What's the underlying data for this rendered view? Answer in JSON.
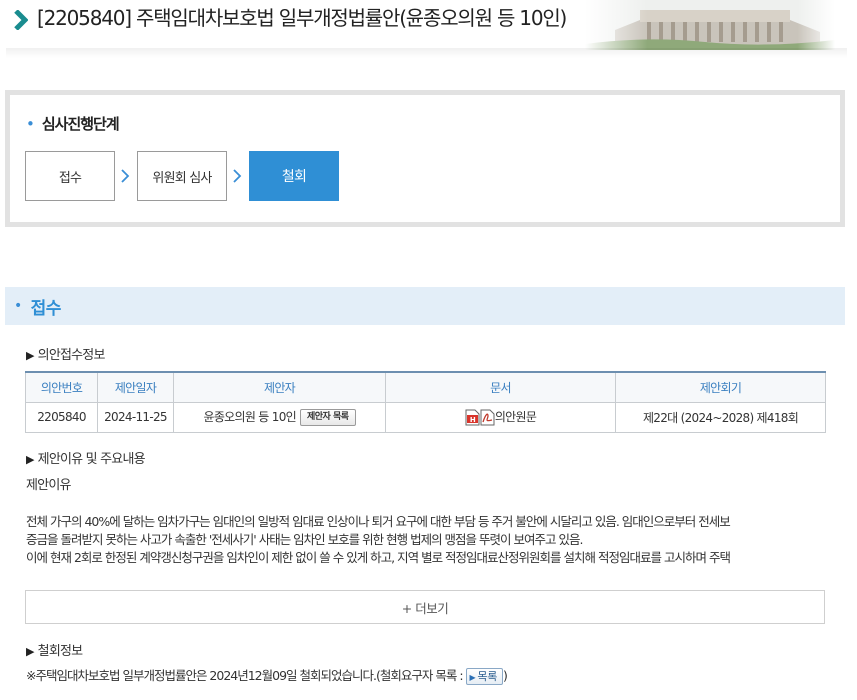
{
  "header": {
    "bill_title": "[2205840] 주택임대차보호법 일부개정법률안(윤종오의원 등 10인)"
  },
  "stages": {
    "heading": "심사진행단계",
    "steps": [
      {
        "label": "접수",
        "active": false
      },
      {
        "label": "위원회 심사",
        "active": false
      },
      {
        "label": "철회",
        "active": true
      }
    ]
  },
  "section": {
    "title": "접수"
  },
  "receipt_info": {
    "heading": "의안접수정보",
    "columns": [
      "의안번호",
      "제안일자",
      "제안자",
      "문서",
      "제안회기"
    ],
    "row": {
      "bill_no": "2205840",
      "date": "2024-11-25",
      "proposer": "윤종오의원 등 10인",
      "proposer_button": "제안자 목록",
      "document": "의안원문",
      "session": "제22대 (2024~2028) 제418회"
    }
  },
  "reason": {
    "heading": "제안이유 및 주요내용",
    "label": "제안이유",
    "lines": [
      "전체 가구의 40%에 달하는 임차가구는 임대인의 일방적 임대료 인상이나 퇴거 요구에 대한 부담 등 주거 불안에 시달리고 있음. 임대인으로부터 전세보",
      "증금을 돌려받지 못하는 사고가 속출한 '전세사기' 사태는 임차인 보호를 위한 현행 법제의 맹점을 뚜렷이 보여주고 있음.",
      "이에 현재 2회로 한정된 계약갱신청구권을 임차인이 제한 없이 쓸 수 있게 하고, 지역 별로 적정임대료산정위원회를 설치해 적정임대료를 고시하며 주택"
    ],
    "more_button": "+ 더보기"
  },
  "withdrawal": {
    "heading": "철회정보",
    "note": "※주택임대차보호법 일부개정법률안은 2024년12월09일 철회되었습니다.(철회요구자 목록 :",
    "list_button": "목록",
    "close_paren": ")"
  },
  "colors": {
    "accent": "#2f8fd5",
    "section_bg": "#e3eef8",
    "table_header_text": "#3a7fc0"
  }
}
